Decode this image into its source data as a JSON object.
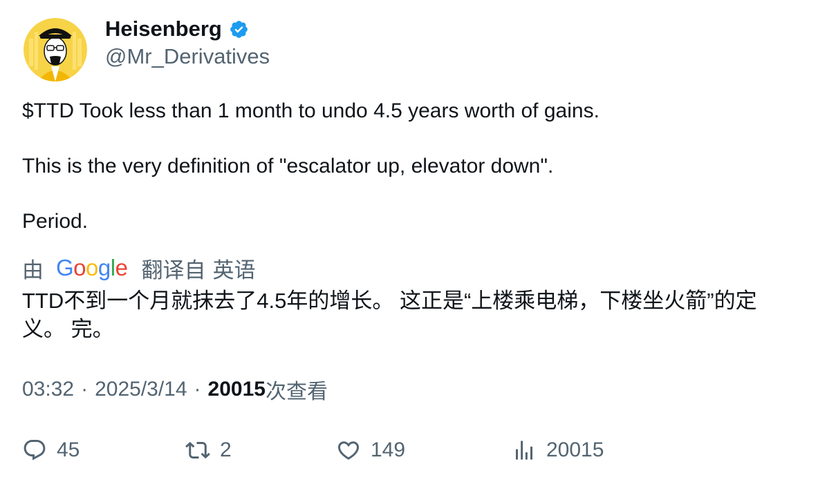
{
  "author": {
    "display_name": "Heisenberg",
    "handle": "@Mr_Derivatives",
    "verified": true,
    "avatar_icon": "heisenberg-cartoon-avatar"
  },
  "tweet": {
    "paragraphs": [
      "$TTD Took less than 1 month to undo 4.5 years worth of gains.",
      "This is the very definition of \"escalator up, elevator down\".",
      "Period."
    ]
  },
  "translation": {
    "prefix": "由",
    "provider": "Google",
    "label": "翻译自",
    "language": "英语",
    "text": "TTD不到一个月就抹去了4.5年的增长。 这正是“上楼乘电梯，下楼坐火箭”的定义。 完。"
  },
  "meta": {
    "time": "03:32",
    "date": "2025/3/14",
    "views_count": "20015",
    "views_label": "次查看"
  },
  "actions": {
    "replies": "45",
    "retweets": "2",
    "likes": "149",
    "views": "20015"
  },
  "colors": {
    "text": "#0f1419",
    "muted": "#536471",
    "verified": "#1d9bf0",
    "avatar_bg": "#f7d347"
  }
}
